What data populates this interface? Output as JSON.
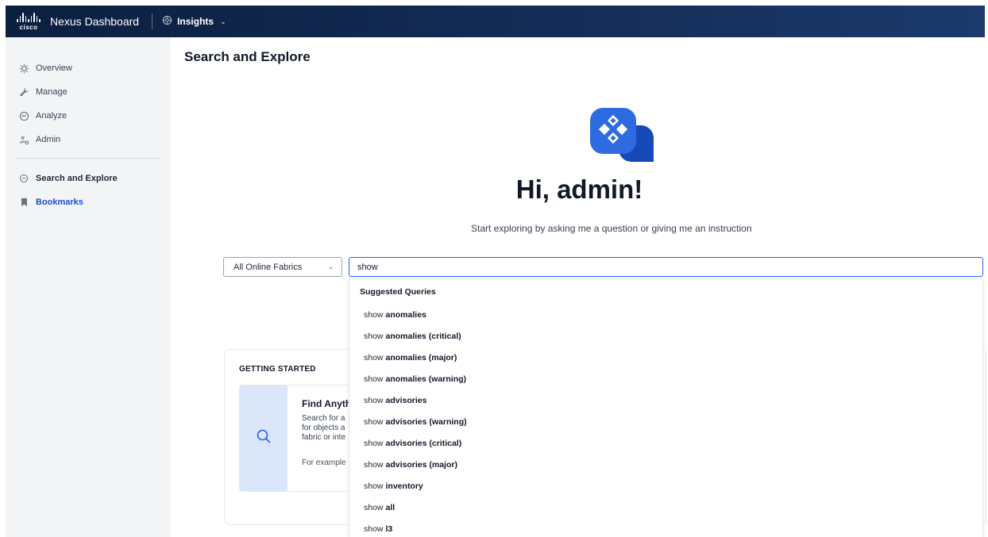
{
  "topbar": {
    "brand_text": "cisco",
    "app_title": "Nexus Dashboard",
    "service_label": "Insights"
  },
  "sidebar": {
    "items": [
      {
        "label": "Overview",
        "icon": "overview-icon"
      },
      {
        "label": "Manage",
        "icon": "wrench-icon"
      },
      {
        "label": "Analyze",
        "icon": "analyze-icon"
      },
      {
        "label": "Admin",
        "icon": "admin-icon"
      }
    ],
    "secondary": [
      {
        "label": "Search and Explore",
        "icon": "search-explore-icon"
      },
      {
        "label": "Bookmarks",
        "icon": "bookmark-icon"
      }
    ]
  },
  "main": {
    "page_title": "Search and Explore",
    "greeting": "Hi, admin!",
    "subtitle": "Start exploring by asking me a question or giving me an instruction",
    "fabric_select": "All Online Fabrics",
    "search_value": "show"
  },
  "suggestions": {
    "header": "Suggested Queries",
    "prefix": "show",
    "items": [
      "anomalies",
      "anomalies (critical)",
      "anomalies (major)",
      "anomalies (warning)",
      "advisories",
      "advisories (warning)",
      "advisories (critical)",
      "advisories (major)",
      "inventory",
      "all",
      "l3"
    ]
  },
  "getting_started": {
    "title": "GETTING STARTED",
    "tile_title": "Find Anyth",
    "tile_desc_lines": [
      "Search for a",
      "for objects a",
      "fabric or inte"
    ],
    "tile_example": "For example"
  },
  "colors": {
    "topbar": "#142c56",
    "accent": "#2563eb",
    "sidebar_bg": "#f3f4f6",
    "tile_left": "#dbe6fb"
  }
}
